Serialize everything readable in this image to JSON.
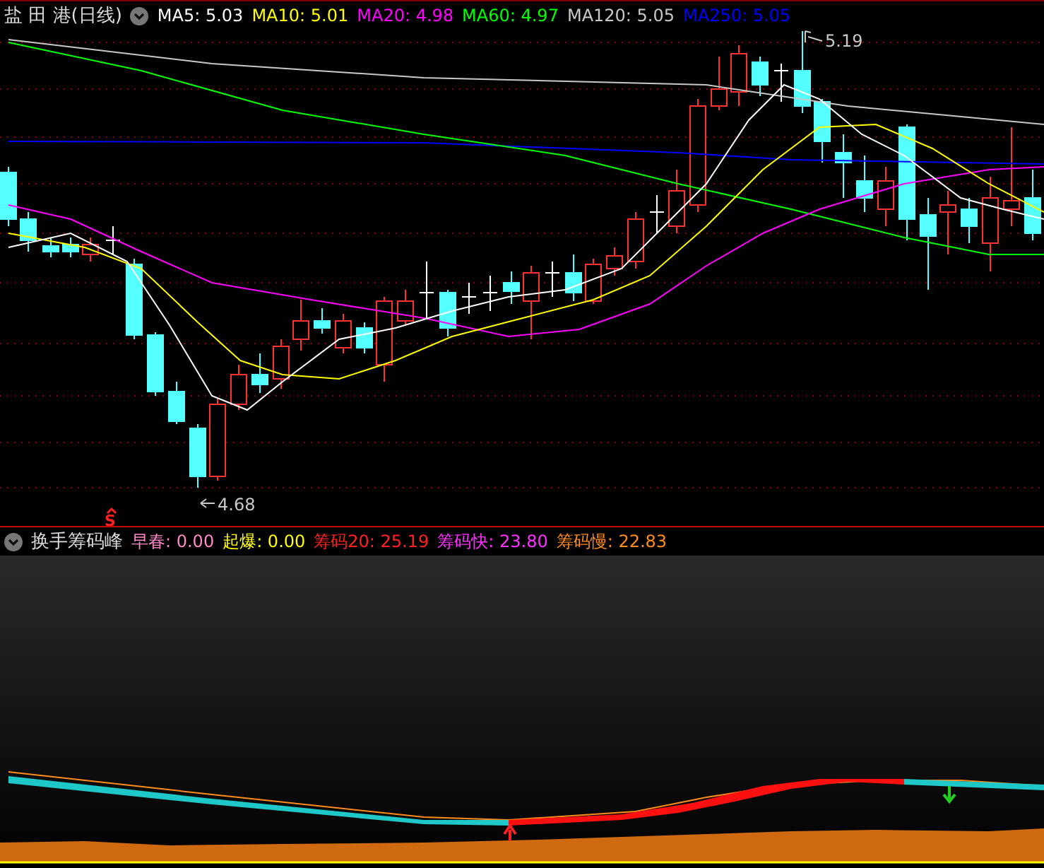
{
  "main_panel": {
    "title": "盐 田 港(日线)",
    "indicators": [
      {
        "label": "MA5: 5.03",
        "color": "#ffffff"
      },
      {
        "label": "MA10: 5.01",
        "color": "#ffff00"
      },
      {
        "label": "MA20: 4.98",
        "color": "#ff00ff"
      },
      {
        "label": "MA60: 4.97",
        "color": "#00ff00"
      },
      {
        "label": "MA120: 5.05",
        "color": "#c8c8c8"
      },
      {
        "label": "MA250: 5.05",
        "color": "#0000ff"
      }
    ],
    "high_label": "5.19",
    "low_label": "4.68",
    "signal_label": "S"
  },
  "sub_panel": {
    "title": "换手筹码峰",
    "indicators": [
      {
        "label": "早春: 0.00",
        "color": "#ff88c8"
      },
      {
        "label": "起爆: 0.00",
        "color": "#ffff00"
      },
      {
        "label": "筹码20: 25.19",
        "color": "#ff2020"
      },
      {
        "label": "筹码快: 23.80",
        "color": "#ff30ff"
      },
      {
        "label": "筹码慢: 22.83",
        "color": "#ff8c1a"
      }
    ]
  }
}
